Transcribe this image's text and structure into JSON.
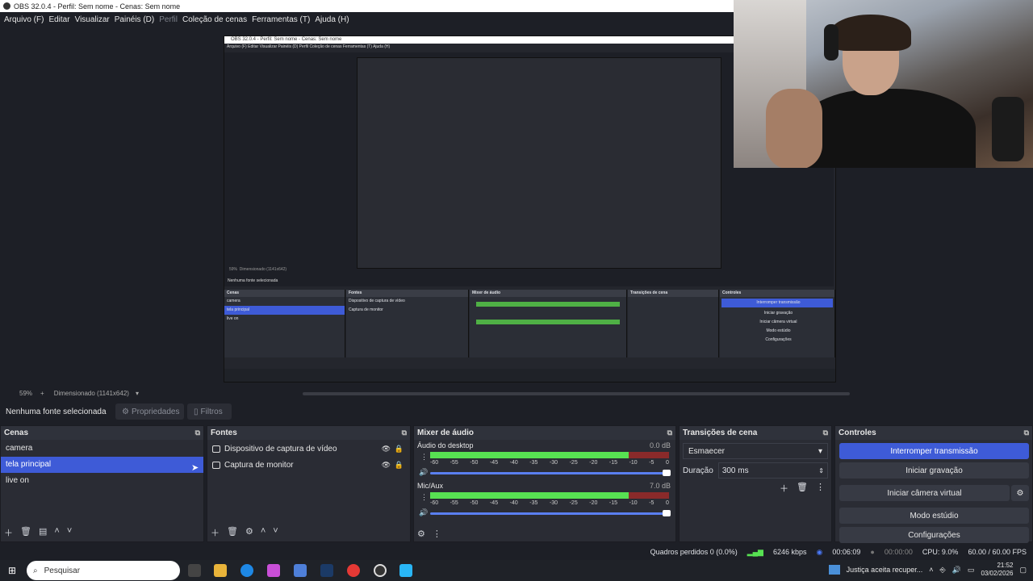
{
  "window": {
    "title": "OBS 32.0.4 - Perfil: Sem nome - Cenas: Sem nome"
  },
  "menu": {
    "items": [
      "Arquivo (F)",
      "Editar",
      "Visualizar",
      "Painéis (D)",
      "Perfil",
      "Coleção de cenas",
      "Ferramentas (T)",
      "Ajuda (H)"
    ],
    "disabled": "Perfil"
  },
  "nested": {
    "title": "OBS 32.0.4 - Perfil: Sem nome - Cenas: Sem nome",
    "menu": "Arquivo (F)   Editar   Visualizar   Painéis (D)   Perfil   Coleção de cenas   Ferramentas (T)   Ajuda (H)",
    "zoom": "59%",
    "scale": "Dimensionado (1141x642)",
    "source_status": "Nenhuma fonte selecionada",
    "docks": {
      "scenes": "Cenas",
      "sources": "Fontes",
      "mixer": "Mixer de áudio",
      "transitions": "Transições de cena",
      "controls": "Controles"
    },
    "scenes": [
      "camera",
      "tela principal",
      "live on"
    ],
    "sources": [
      "Dispositivo de captura de vídeo",
      "Captura de monitor"
    ],
    "controls": [
      "Interromper transmissão",
      "Iniciar gravação",
      "Iniciar câmera virtual",
      "Modo estúdio",
      "Configurações"
    ]
  },
  "preview": {
    "zoom": "59%",
    "scale": "Dimensionado (1141x642)"
  },
  "source_bar": {
    "none_selected": "Nenhuma fonte selecionada",
    "properties": "Propriedades",
    "filters": "Filtros"
  },
  "scenes": {
    "title": "Cenas",
    "items": [
      "camera",
      "tela principal",
      "live on"
    ],
    "selected_index": 1
  },
  "sources": {
    "title": "Fontes",
    "items": [
      {
        "name": "Dispositivo de captura de vídeo",
        "icon": "camera-icon"
      },
      {
        "name": "Captura de monitor",
        "icon": "monitor-icon"
      }
    ]
  },
  "mixer": {
    "title": "Mixer de áudio",
    "channels": [
      {
        "name": "Áudio do desktop",
        "db": "0.0 dB",
        "level": 0.83
      },
      {
        "name": "Mic/Aux",
        "db": "7.0 dB",
        "level": 0.83
      }
    ],
    "ticks": [
      "-60",
      "-55",
      "-50",
      "-45",
      "-40",
      "-35",
      "-30",
      "-25",
      "-20",
      "-15",
      "-10",
      "-5",
      "0"
    ]
  },
  "transitions": {
    "title": "Transições de cena",
    "selected": "Esmaecer",
    "duration_label": "Duração",
    "duration": "300 ms"
  },
  "controls": {
    "title": "Controles",
    "buttons": [
      "Interromper transmissão",
      "Iniciar gravação",
      "Iniciar câmera virtual",
      "Modo estúdio",
      "Configurações"
    ],
    "active_index": 0
  },
  "status": {
    "dropped": "Quadros perdidos 0 (0.0%)",
    "bitrate": "6246 kbps",
    "stream_time": "00:06:09",
    "rec_time": "00:00:00",
    "cpu": "CPU: 9.0%",
    "fps": "60.00 / 60.00 FPS"
  },
  "taskbar": {
    "search_placeholder": "Pesquisar",
    "notification": "Justiça aceita recuper...",
    "time": "21:52",
    "date": "03/02/2026"
  },
  "colors": {
    "accent": "#3e5bd7",
    "background": "#1d1f26",
    "dock": "#2a2c34",
    "meter_green": "#57e152",
    "meter_yellow": "#a79a2c",
    "meter_red": "#8a2a2a"
  }
}
